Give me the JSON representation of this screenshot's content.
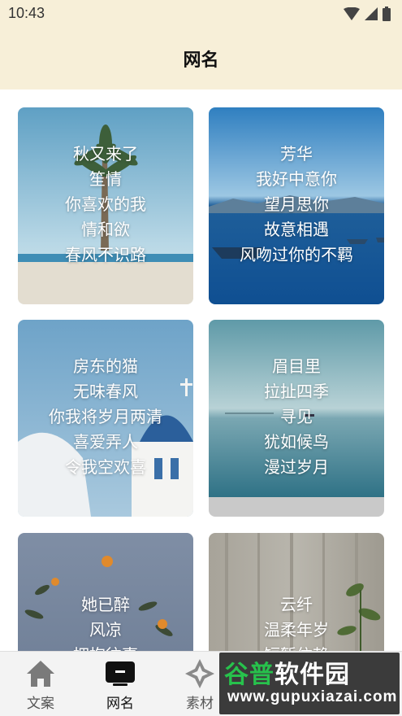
{
  "status_bar": {
    "time": "10:43",
    "icons": [
      "wifi-icon",
      "signal-icon",
      "battery-icon"
    ]
  },
  "header": {
    "title": "网名"
  },
  "cards": [
    {
      "lines": [
        "秋又来了",
        "笙情",
        "你喜欢的我",
        "情和欲",
        "春风不识路"
      ],
      "scene": "palm-beach"
    },
    {
      "lines": [
        "芳华",
        "我好中意你",
        "望月思你",
        "故意相遇",
        "风吻过你的不羁"
      ],
      "scene": "lake-boats"
    },
    {
      "lines": [
        "房东的猫",
        "无味春风",
        "你我将岁月两清",
        "喜爱弄人",
        "令我空欢喜"
      ],
      "scene": "church-dome"
    },
    {
      "lines": [
        "眉目里",
        "拉扯四季",
        "寻见",
        "犹如候鸟",
        "漫过岁月"
      ],
      "scene": "calm-sea"
    },
    {
      "lines": [
        "她已醉",
        "风凉",
        "拥抱往事"
      ],
      "scene": "flowers-dusk"
    },
    {
      "lines": [
        "云纤",
        "温柔年岁",
        "短暂依赖"
      ],
      "scene": "curtain-plant"
    }
  ],
  "tabs": [
    {
      "label": "文案",
      "icon": "home-icon",
      "active": false
    },
    {
      "label": "网名",
      "icon": "tv-icon",
      "active": true
    },
    {
      "label": "素材",
      "icon": "diamond-star-icon",
      "active": false
    }
  ],
  "watermark": {
    "title_part1": "谷普",
    "title_part2": "软件园",
    "url": "www.gupuxiazai.com"
  },
  "colors": {
    "header_bg": "#f7efd8",
    "tab_bar_bg": "#f3f3f3",
    "watermark_green": "#27c24c"
  }
}
